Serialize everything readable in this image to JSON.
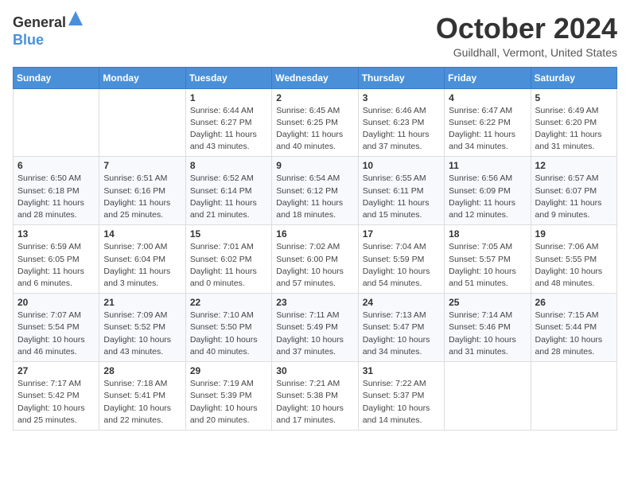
{
  "logo": {
    "line1": "General",
    "line2": "Blue"
  },
  "title": "October 2024",
  "location": "Guildhall, Vermont, United States",
  "days_of_week": [
    "Sunday",
    "Monday",
    "Tuesday",
    "Wednesday",
    "Thursday",
    "Friday",
    "Saturday"
  ],
  "weeks": [
    [
      {
        "day": "",
        "sunrise": "",
        "sunset": "",
        "daylight": ""
      },
      {
        "day": "",
        "sunrise": "",
        "sunset": "",
        "daylight": ""
      },
      {
        "day": "1",
        "sunrise": "Sunrise: 6:44 AM",
        "sunset": "Sunset: 6:27 PM",
        "daylight": "Daylight: 11 hours and 43 minutes."
      },
      {
        "day": "2",
        "sunrise": "Sunrise: 6:45 AM",
        "sunset": "Sunset: 6:25 PM",
        "daylight": "Daylight: 11 hours and 40 minutes."
      },
      {
        "day": "3",
        "sunrise": "Sunrise: 6:46 AM",
        "sunset": "Sunset: 6:23 PM",
        "daylight": "Daylight: 11 hours and 37 minutes."
      },
      {
        "day": "4",
        "sunrise": "Sunrise: 6:47 AM",
        "sunset": "Sunset: 6:22 PM",
        "daylight": "Daylight: 11 hours and 34 minutes."
      },
      {
        "day": "5",
        "sunrise": "Sunrise: 6:49 AM",
        "sunset": "Sunset: 6:20 PM",
        "daylight": "Daylight: 11 hours and 31 minutes."
      }
    ],
    [
      {
        "day": "6",
        "sunrise": "Sunrise: 6:50 AM",
        "sunset": "Sunset: 6:18 PM",
        "daylight": "Daylight: 11 hours and 28 minutes."
      },
      {
        "day": "7",
        "sunrise": "Sunrise: 6:51 AM",
        "sunset": "Sunset: 6:16 PM",
        "daylight": "Daylight: 11 hours and 25 minutes."
      },
      {
        "day": "8",
        "sunrise": "Sunrise: 6:52 AM",
        "sunset": "Sunset: 6:14 PM",
        "daylight": "Daylight: 11 hours and 21 minutes."
      },
      {
        "day": "9",
        "sunrise": "Sunrise: 6:54 AM",
        "sunset": "Sunset: 6:12 PM",
        "daylight": "Daylight: 11 hours and 18 minutes."
      },
      {
        "day": "10",
        "sunrise": "Sunrise: 6:55 AM",
        "sunset": "Sunset: 6:11 PM",
        "daylight": "Daylight: 11 hours and 15 minutes."
      },
      {
        "day": "11",
        "sunrise": "Sunrise: 6:56 AM",
        "sunset": "Sunset: 6:09 PM",
        "daylight": "Daylight: 11 hours and 12 minutes."
      },
      {
        "day": "12",
        "sunrise": "Sunrise: 6:57 AM",
        "sunset": "Sunset: 6:07 PM",
        "daylight": "Daylight: 11 hours and 9 minutes."
      }
    ],
    [
      {
        "day": "13",
        "sunrise": "Sunrise: 6:59 AM",
        "sunset": "Sunset: 6:05 PM",
        "daylight": "Daylight: 11 hours and 6 minutes."
      },
      {
        "day": "14",
        "sunrise": "Sunrise: 7:00 AM",
        "sunset": "Sunset: 6:04 PM",
        "daylight": "Daylight: 11 hours and 3 minutes."
      },
      {
        "day": "15",
        "sunrise": "Sunrise: 7:01 AM",
        "sunset": "Sunset: 6:02 PM",
        "daylight": "Daylight: 11 hours and 0 minutes."
      },
      {
        "day": "16",
        "sunrise": "Sunrise: 7:02 AM",
        "sunset": "Sunset: 6:00 PM",
        "daylight": "Daylight: 10 hours and 57 minutes."
      },
      {
        "day": "17",
        "sunrise": "Sunrise: 7:04 AM",
        "sunset": "Sunset: 5:59 PM",
        "daylight": "Daylight: 10 hours and 54 minutes."
      },
      {
        "day": "18",
        "sunrise": "Sunrise: 7:05 AM",
        "sunset": "Sunset: 5:57 PM",
        "daylight": "Daylight: 10 hours and 51 minutes."
      },
      {
        "day": "19",
        "sunrise": "Sunrise: 7:06 AM",
        "sunset": "Sunset: 5:55 PM",
        "daylight": "Daylight: 10 hours and 48 minutes."
      }
    ],
    [
      {
        "day": "20",
        "sunrise": "Sunrise: 7:07 AM",
        "sunset": "Sunset: 5:54 PM",
        "daylight": "Daylight: 10 hours and 46 minutes."
      },
      {
        "day": "21",
        "sunrise": "Sunrise: 7:09 AM",
        "sunset": "Sunset: 5:52 PM",
        "daylight": "Daylight: 10 hours and 43 minutes."
      },
      {
        "day": "22",
        "sunrise": "Sunrise: 7:10 AM",
        "sunset": "Sunset: 5:50 PM",
        "daylight": "Daylight: 10 hours and 40 minutes."
      },
      {
        "day": "23",
        "sunrise": "Sunrise: 7:11 AM",
        "sunset": "Sunset: 5:49 PM",
        "daylight": "Daylight: 10 hours and 37 minutes."
      },
      {
        "day": "24",
        "sunrise": "Sunrise: 7:13 AM",
        "sunset": "Sunset: 5:47 PM",
        "daylight": "Daylight: 10 hours and 34 minutes."
      },
      {
        "day": "25",
        "sunrise": "Sunrise: 7:14 AM",
        "sunset": "Sunset: 5:46 PM",
        "daylight": "Daylight: 10 hours and 31 minutes."
      },
      {
        "day": "26",
        "sunrise": "Sunrise: 7:15 AM",
        "sunset": "Sunset: 5:44 PM",
        "daylight": "Daylight: 10 hours and 28 minutes."
      }
    ],
    [
      {
        "day": "27",
        "sunrise": "Sunrise: 7:17 AM",
        "sunset": "Sunset: 5:42 PM",
        "daylight": "Daylight: 10 hours and 25 minutes."
      },
      {
        "day": "28",
        "sunrise": "Sunrise: 7:18 AM",
        "sunset": "Sunset: 5:41 PM",
        "daylight": "Daylight: 10 hours and 22 minutes."
      },
      {
        "day": "29",
        "sunrise": "Sunrise: 7:19 AM",
        "sunset": "Sunset: 5:39 PM",
        "daylight": "Daylight: 10 hours and 20 minutes."
      },
      {
        "day": "30",
        "sunrise": "Sunrise: 7:21 AM",
        "sunset": "Sunset: 5:38 PM",
        "daylight": "Daylight: 10 hours and 17 minutes."
      },
      {
        "day": "31",
        "sunrise": "Sunrise: 7:22 AM",
        "sunset": "Sunset: 5:37 PM",
        "daylight": "Daylight: 10 hours and 14 minutes."
      },
      {
        "day": "",
        "sunrise": "",
        "sunset": "",
        "daylight": ""
      },
      {
        "day": "",
        "sunrise": "",
        "sunset": "",
        "daylight": ""
      }
    ]
  ]
}
